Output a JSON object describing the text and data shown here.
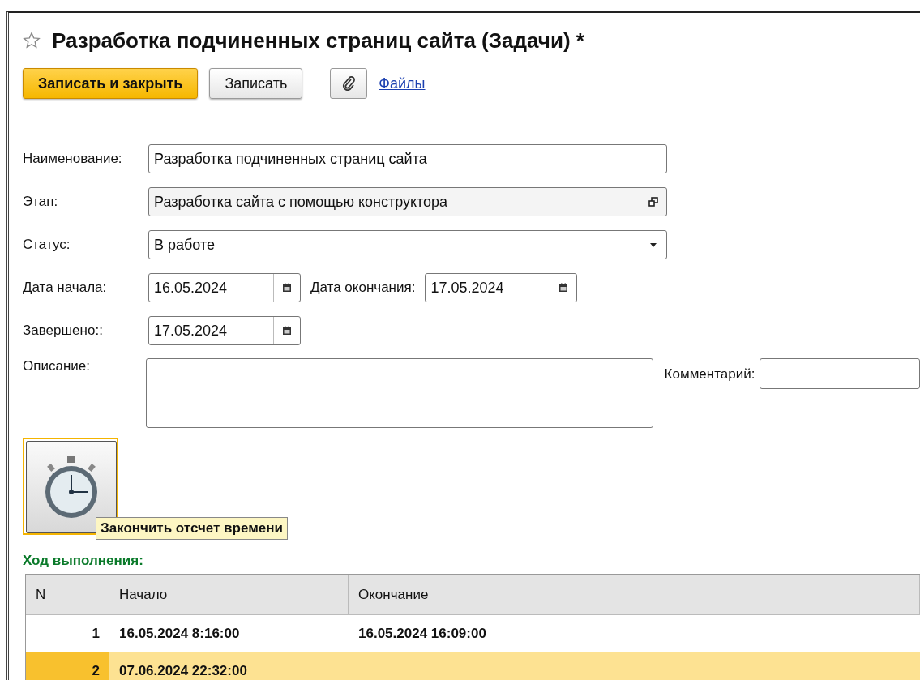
{
  "window": {
    "title": "Разработка подчиненных страниц сайта (Задачи) *",
    "favorite": false
  },
  "toolbar": {
    "buttons": [
      {
        "label": "Записать и закрыть",
        "kind": "primary"
      },
      {
        "label": "Записать",
        "kind": "default"
      }
    ],
    "files_link": "Файлы"
  },
  "fields": [
    {
      "label": "Наименование:",
      "value": "Разработка подчиненных страниц сайта",
      "kind": "text"
    },
    {
      "label": "Этап:",
      "value": "Разработка сайта с помощью конструктора",
      "kind": "open"
    },
    {
      "label": "Статус:",
      "value": "В работе",
      "kind": "select"
    }
  ],
  "dates": {
    "start": {
      "label": "Дата начала:",
      "value": "16.05.2024"
    },
    "end": {
      "label": "Дата окончания:",
      "value": "17.05.2024"
    },
    "done": {
      "label": "Завершено::",
      "value": "17.05.2024"
    }
  },
  "description": {
    "label": "Описание:"
  },
  "comment": {
    "label": "Комментарий:"
  },
  "timer_button": {
    "tooltip": "Закончить отсчет времени"
  },
  "progress": {
    "title": "Ход выполнения:",
    "columns": [
      "N",
      "Начало",
      "Окончание"
    ],
    "rows": [
      {
        "n": "1",
        "start": "16.05.2024 8:16:00",
        "end": "16.05.2024 16:09:00",
        "selected": false
      },
      {
        "n": "2",
        "start": "07.06.2024 22:32:00",
        "end": "",
        "selected": true
      }
    ]
  }
}
